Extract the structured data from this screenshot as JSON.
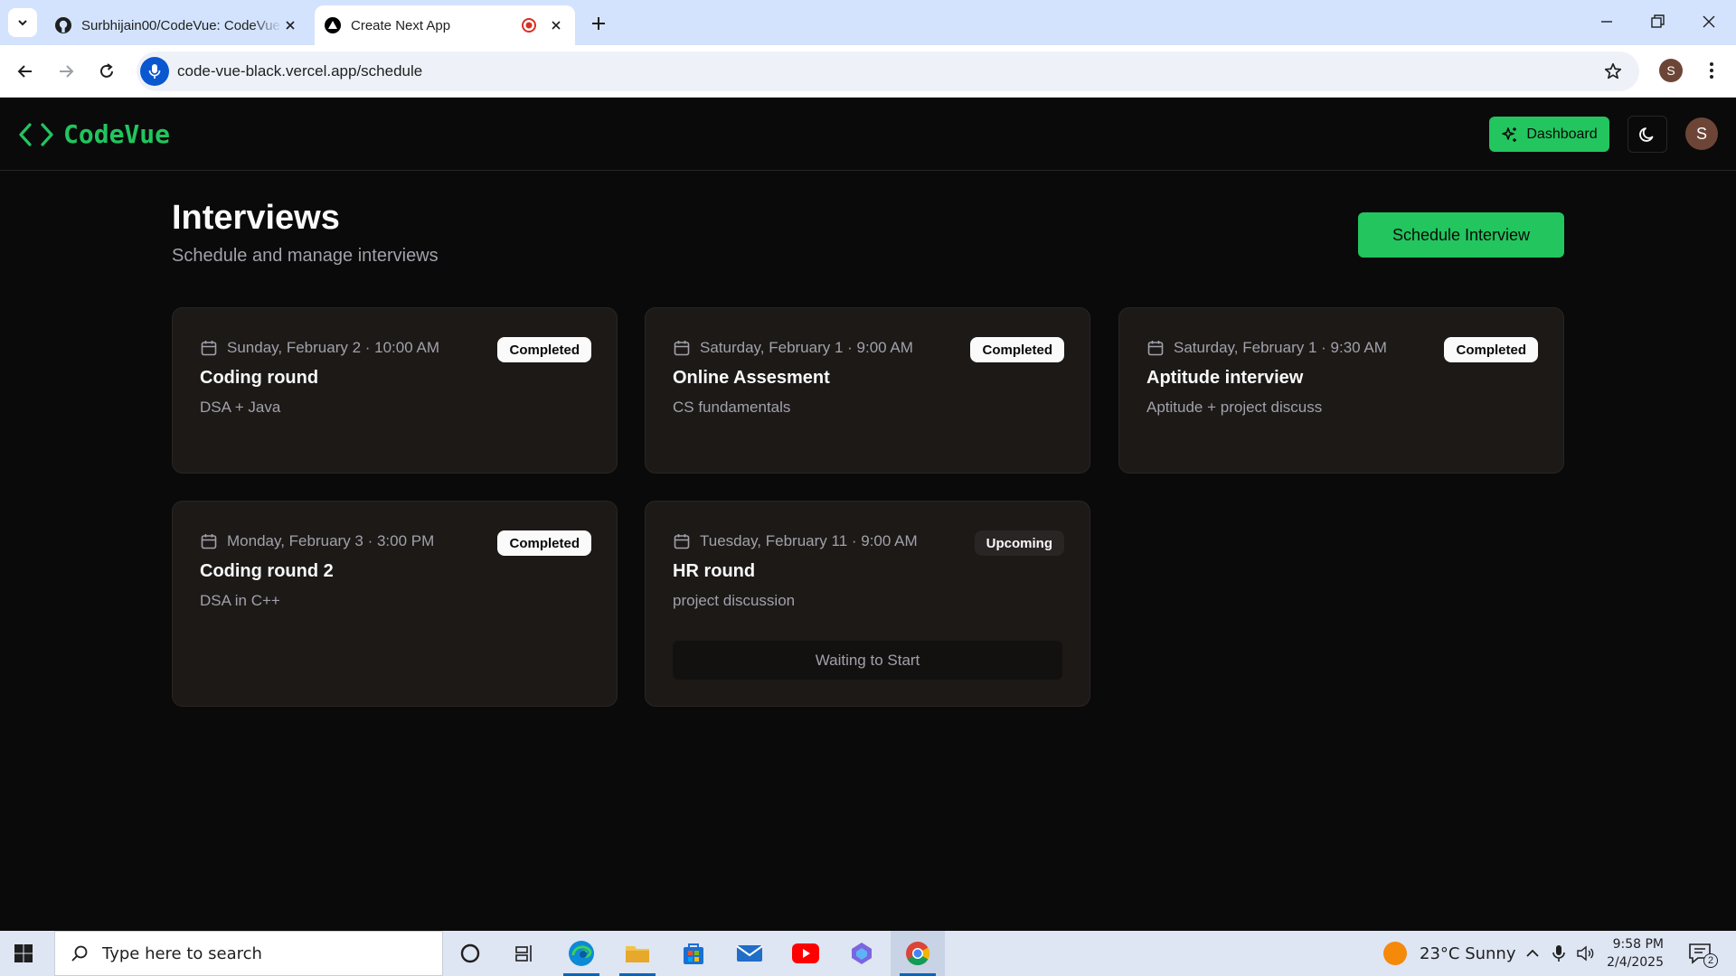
{
  "browser": {
    "tabs": [
      {
        "title": "Surbhijain00/CodeVue: CodeVue",
        "favicon": "github-icon",
        "active": false
      },
      {
        "title": "Create Next App",
        "favicon": "nextjs-icon",
        "active": true
      }
    ],
    "url": "code-vue-black.vercel.app/schedule",
    "profile_initial": "S"
  },
  "app": {
    "brand": "CodeVue",
    "brand_color": "#22c55e",
    "header": {
      "dashboard_label": "Dashboard",
      "avatar_initial": "S"
    },
    "page": {
      "title": "Interviews",
      "subtitle": "Schedule and manage interviews",
      "schedule_button": "Schedule Interview"
    },
    "interviews": [
      {
        "date": "Sunday, February 2 · 10:00 AM",
        "status": "Completed",
        "title": "Coding round",
        "description": "DSA + Java"
      },
      {
        "date": "Saturday, February 1 · 9:00 AM",
        "status": "Completed",
        "title": "Online Assesment",
        "description": "CS fundamentals"
      },
      {
        "date": "Saturday, February 1 · 9:30 AM",
        "status": "Completed",
        "title": "Aptitude interview",
        "description": "Aptitude + project discuss"
      },
      {
        "date": "Monday, February 3 · 3:00 PM",
        "status": "Completed",
        "title": "Coding round 2",
        "description": "DSA in C++"
      },
      {
        "date": "Tuesday, February 11 · 9:00 AM",
        "status": "Upcoming",
        "title": "HR round",
        "description": "project discussion",
        "action": "Waiting to Start"
      }
    ]
  },
  "taskbar": {
    "search_placeholder": "Type here to search",
    "weather": "23°C  Sunny",
    "time": "9:58 PM",
    "date": "2/4/2025",
    "notification_count": "2"
  }
}
